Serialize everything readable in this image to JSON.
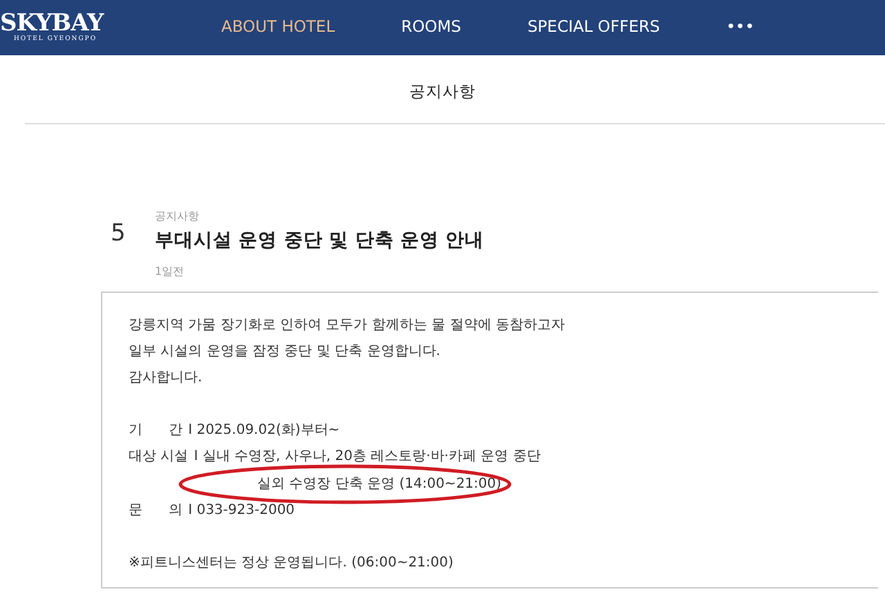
{
  "navbar": {
    "logo": {
      "name": "SKYBAY",
      "subtitle": "HOTEL GYEONGPO"
    },
    "items": [
      {
        "label": "ABOUT HOTEL",
        "selected": true
      },
      {
        "label": "ROOMS",
        "selected": false
      },
      {
        "label": "SPECIAL OFFERS",
        "selected": false
      },
      {
        "label": "•••",
        "selected": false
      }
    ]
  },
  "page_header": {
    "subtitle": "공지사항"
  },
  "notice": {
    "number": "5",
    "category": "공지사항",
    "title": "부대시설 운영 중단 및 단축 운영 안내",
    "date": "1일전",
    "body": [
      {
        "kind": "text",
        "text": "강릉지역 가뭄 장기화로 인하여 모두가 함께하는 물 절약에 동참하고자"
      },
      {
        "kind": "text",
        "text": "일부 시설의 운영을 잠정 중단 및 단축 운영합니다."
      },
      {
        "kind": "text",
        "text": "감사합니다."
      },
      {
        "kind": "spacer"
      },
      {
        "kind": "field",
        "label": "기      간",
        "value": "I 2025.09.02(화)부터~"
      },
      {
        "kind": "field",
        "label": "대상 시설",
        "value": "I 실내 수영장, 사우나, 20층 레스토랑·바·카페 운영 중단"
      },
      {
        "kind": "continuation",
        "text": "실외 수영장 단축 운영 (14:00~21:00)",
        "highlighted": true
      },
      {
        "kind": "field",
        "label": "문      의",
        "value": "I 033-923-2000"
      },
      {
        "kind": "spacer"
      },
      {
        "kind": "text",
        "text": "※피트니스센터는 정상 운영됩니다. (06:00~21:00)"
      }
    ]
  }
}
